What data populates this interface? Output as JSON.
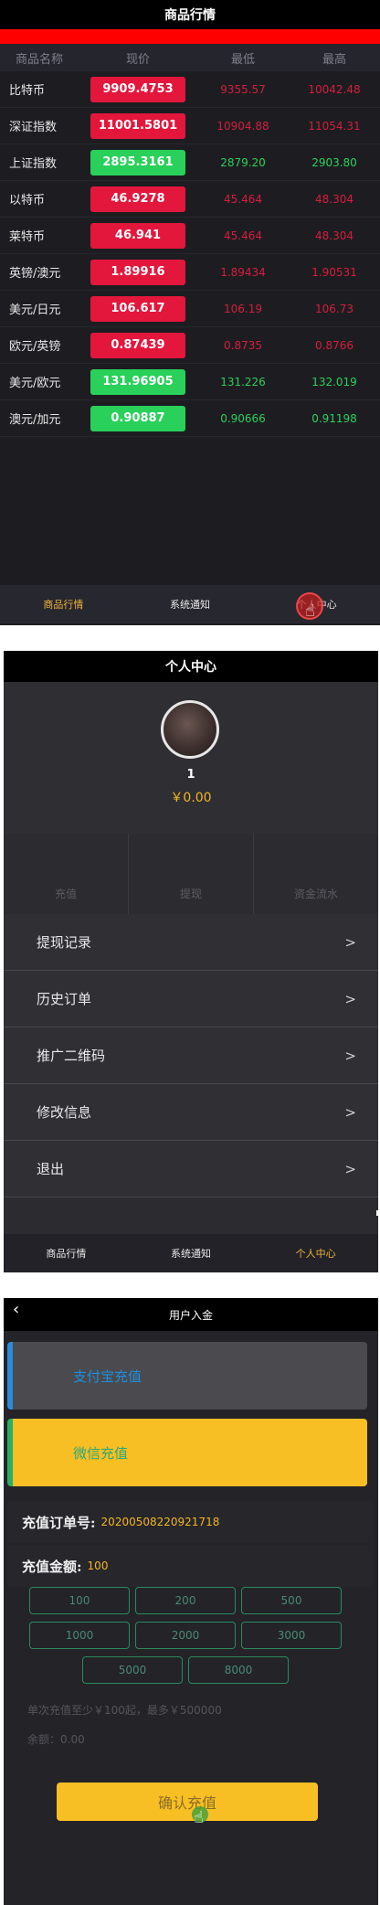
{
  "market": {
    "title": "商品行情",
    "columns": [
      "商品名称",
      "现价",
      "最低",
      "最高"
    ],
    "rows": [
      {
        "name": "比特币",
        "price": "9909.4753",
        "low": "9355.57",
        "high": "10042.48",
        "trend": "up"
      },
      {
        "name": "深证指数",
        "price": "11001.5801",
        "low": "10904.88",
        "high": "11054.31",
        "trend": "up"
      },
      {
        "name": "上证指数",
        "price": "2895.3161",
        "low": "2879.20",
        "high": "2903.80",
        "trend": "down"
      },
      {
        "name": "以特币",
        "price": "46.9278",
        "low": "45.464",
        "high": "48.304",
        "trend": "up"
      },
      {
        "name": "莱特币",
        "price": "46.941",
        "low": "45.464",
        "high": "48.304",
        "trend": "up"
      },
      {
        "name": "英镑/澳元",
        "price": "1.89916",
        "low": "1.89434",
        "high": "1.90531",
        "trend": "up"
      },
      {
        "name": "美元/日元",
        "price": "106.617",
        "low": "106.19",
        "high": "106.73",
        "trend": "up"
      },
      {
        "name": "欧元/英镑",
        "price": "0.87439",
        "low": "0.8735",
        "high": "0.8766",
        "trend": "up"
      },
      {
        "name": "美元/欧元",
        "price": "131.96905",
        "low": "131.226",
        "high": "132.019",
        "trend": "down"
      },
      {
        "name": "澳元/加元",
        "price": "0.90887",
        "low": "0.90666",
        "high": "0.91198",
        "trend": "down"
      }
    ],
    "nav": [
      "商品行情",
      "系统通知",
      "个人中心"
    ],
    "active_nav": 0
  },
  "profile": {
    "title": "个人中心",
    "username": "1",
    "balance": "￥0.00",
    "quick_actions": [
      "充值",
      "提现",
      "资金流水"
    ],
    "menu": [
      {
        "label": "提现记录",
        "chevron": ">"
      },
      {
        "label": "历史订单",
        "chevron": ">"
      },
      {
        "label": "推广二维码",
        "chevron": ">"
      },
      {
        "label": "修改信息",
        "chevron": ">"
      },
      {
        "label": "退出",
        "chevron": ">"
      }
    ],
    "nav": [
      "商品行情",
      "系统通知",
      "个人中心"
    ],
    "active_nav": 2
  },
  "deposit": {
    "title": "用户入金",
    "back_icon": "‹",
    "methods": [
      "支付宝充值",
      "微信充值"
    ],
    "order_label": "充值订单号:",
    "order_no": "20200508220921718",
    "amount_label": "充值金额:",
    "amount": "100",
    "amount_options": [
      "100",
      "200",
      "500",
      "1000",
      "2000",
      "3000",
      "5000",
      "8000"
    ],
    "min_hint": "单次充值至少￥100起，最多￥500000",
    "balance_hint": "余额：0.00",
    "confirm_label": "确认充值"
  },
  "colors": {
    "up": "#e3163c",
    "down": "#29d05a",
    "accent": "#f7bf23",
    "nav_active": "#f2b43a"
  }
}
